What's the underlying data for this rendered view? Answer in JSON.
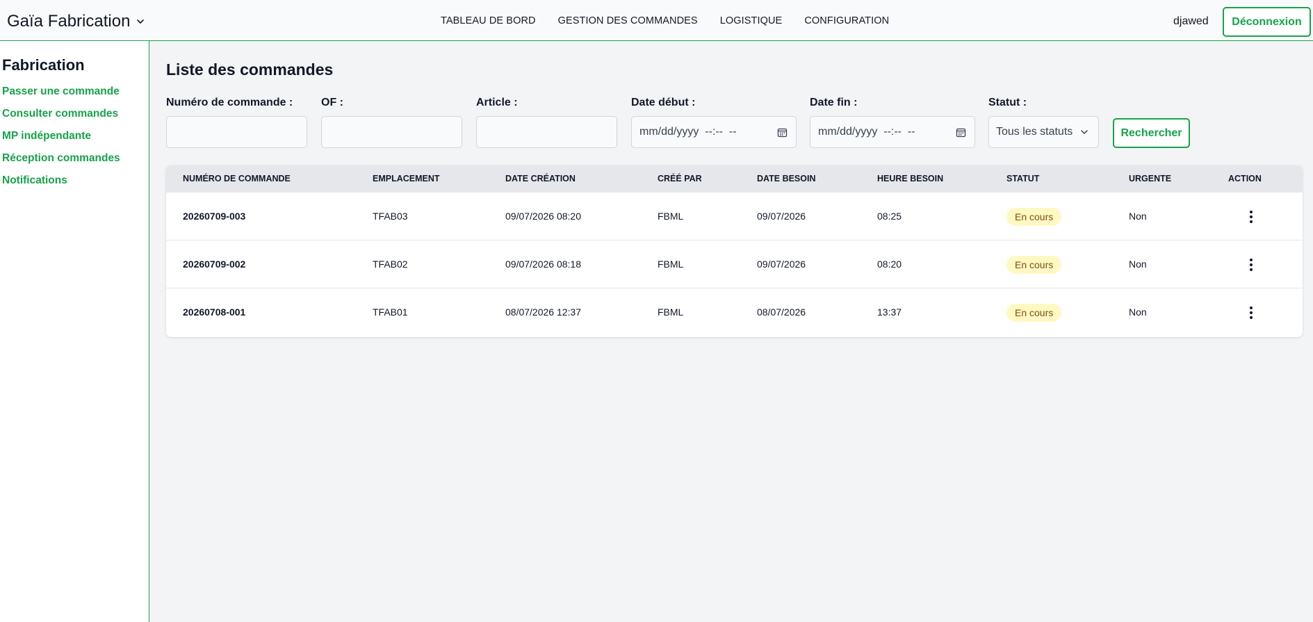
{
  "header": {
    "brand": "Gaïa Fabrication",
    "nav": [
      "TABLEAU DE BORD",
      "GESTION DES COMMANDES",
      "LOGISTIQUE",
      "CONFIGURATION"
    ],
    "user": "djawed",
    "logout_label": "Déconnexion"
  },
  "sidebar": {
    "title": "Fabrication",
    "links": [
      "Passer une commande",
      "Consulter commandes",
      "MP indépendante",
      "Réception commandes",
      "Notifications"
    ]
  },
  "main": {
    "title": "Liste des commandes",
    "filters": {
      "order_number_label": "Numéro de commande :",
      "of_label": "OF :",
      "article_label": "Article :",
      "start_date_label": "Date début :",
      "start_date_placeholder": "mm/dd/yyyy  --:--  --",
      "end_date_label": "Date fin :",
      "end_date_placeholder": "mm/dd/yyyy  --:--  --",
      "status_label": "Statut :",
      "status_value": "Tous les statuts",
      "search_label": "Rechercher"
    },
    "table": {
      "headers": [
        "Numéro de commande",
        "Emplacement",
        "Date création",
        "Créé par",
        "Date besoin",
        "Heure besoin",
        "Statut",
        "Urgente",
        "Action"
      ],
      "rows": [
        {
          "numero": "20260709-003",
          "emplacement": "TFAB03",
          "date_creation": "09/07/2026 08:20",
          "cree_par": "FBML",
          "date_besoin": "09/07/2026",
          "heure_besoin": "08:25",
          "statut": "En cours",
          "urgente": "Non"
        },
        {
          "numero": "20260709-002",
          "emplacement": "TFAB02",
          "date_creation": "09/07/2026 08:18",
          "cree_par": "FBML",
          "date_besoin": "09/07/2026",
          "heure_besoin": "08:20",
          "statut": "En cours",
          "urgente": "Non"
        },
        {
          "numero": "20260708-001",
          "emplacement": "TFAB01",
          "date_creation": "08/07/2026 12:37",
          "cree_par": "FBML",
          "date_besoin": "08/07/2026",
          "heure_besoin": "13:37",
          "statut": "En cours",
          "urgente": "Non"
        }
      ]
    }
  },
  "colors": {
    "accent": "#16a34a",
    "badge_bg": "#fef9c3",
    "badge_text": "#854d0e",
    "table_header_bg": "#e5e7eb",
    "page_bg": "#f3f4f6"
  }
}
